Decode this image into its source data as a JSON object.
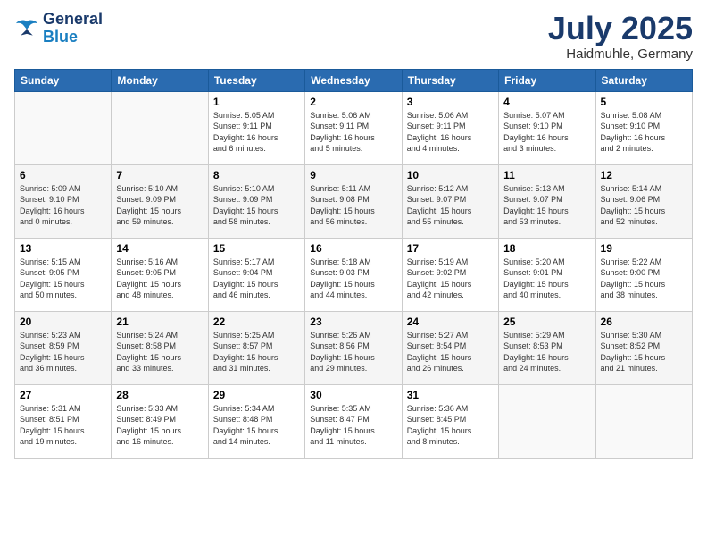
{
  "logo": {
    "line1": "General",
    "line2": "Blue"
  },
  "title": "July 2025",
  "location": "Haidmuhle, Germany",
  "weekdays": [
    "Sunday",
    "Monday",
    "Tuesday",
    "Wednesday",
    "Thursday",
    "Friday",
    "Saturday"
  ],
  "weeks": [
    [
      {
        "day": "",
        "info": ""
      },
      {
        "day": "",
        "info": ""
      },
      {
        "day": "1",
        "info": "Sunrise: 5:05 AM\nSunset: 9:11 PM\nDaylight: 16 hours\nand 6 minutes."
      },
      {
        "day": "2",
        "info": "Sunrise: 5:06 AM\nSunset: 9:11 PM\nDaylight: 16 hours\nand 5 minutes."
      },
      {
        "day": "3",
        "info": "Sunrise: 5:06 AM\nSunset: 9:11 PM\nDaylight: 16 hours\nand 4 minutes."
      },
      {
        "day": "4",
        "info": "Sunrise: 5:07 AM\nSunset: 9:10 PM\nDaylight: 16 hours\nand 3 minutes."
      },
      {
        "day": "5",
        "info": "Sunrise: 5:08 AM\nSunset: 9:10 PM\nDaylight: 16 hours\nand 2 minutes."
      }
    ],
    [
      {
        "day": "6",
        "info": "Sunrise: 5:09 AM\nSunset: 9:10 PM\nDaylight: 16 hours\nand 0 minutes."
      },
      {
        "day": "7",
        "info": "Sunrise: 5:10 AM\nSunset: 9:09 PM\nDaylight: 15 hours\nand 59 minutes."
      },
      {
        "day": "8",
        "info": "Sunrise: 5:10 AM\nSunset: 9:09 PM\nDaylight: 15 hours\nand 58 minutes."
      },
      {
        "day": "9",
        "info": "Sunrise: 5:11 AM\nSunset: 9:08 PM\nDaylight: 15 hours\nand 56 minutes."
      },
      {
        "day": "10",
        "info": "Sunrise: 5:12 AM\nSunset: 9:07 PM\nDaylight: 15 hours\nand 55 minutes."
      },
      {
        "day": "11",
        "info": "Sunrise: 5:13 AM\nSunset: 9:07 PM\nDaylight: 15 hours\nand 53 minutes."
      },
      {
        "day": "12",
        "info": "Sunrise: 5:14 AM\nSunset: 9:06 PM\nDaylight: 15 hours\nand 52 minutes."
      }
    ],
    [
      {
        "day": "13",
        "info": "Sunrise: 5:15 AM\nSunset: 9:05 PM\nDaylight: 15 hours\nand 50 minutes."
      },
      {
        "day": "14",
        "info": "Sunrise: 5:16 AM\nSunset: 9:05 PM\nDaylight: 15 hours\nand 48 minutes."
      },
      {
        "day": "15",
        "info": "Sunrise: 5:17 AM\nSunset: 9:04 PM\nDaylight: 15 hours\nand 46 minutes."
      },
      {
        "day": "16",
        "info": "Sunrise: 5:18 AM\nSunset: 9:03 PM\nDaylight: 15 hours\nand 44 minutes."
      },
      {
        "day": "17",
        "info": "Sunrise: 5:19 AM\nSunset: 9:02 PM\nDaylight: 15 hours\nand 42 minutes."
      },
      {
        "day": "18",
        "info": "Sunrise: 5:20 AM\nSunset: 9:01 PM\nDaylight: 15 hours\nand 40 minutes."
      },
      {
        "day": "19",
        "info": "Sunrise: 5:22 AM\nSunset: 9:00 PM\nDaylight: 15 hours\nand 38 minutes."
      }
    ],
    [
      {
        "day": "20",
        "info": "Sunrise: 5:23 AM\nSunset: 8:59 PM\nDaylight: 15 hours\nand 36 minutes."
      },
      {
        "day": "21",
        "info": "Sunrise: 5:24 AM\nSunset: 8:58 PM\nDaylight: 15 hours\nand 33 minutes."
      },
      {
        "day": "22",
        "info": "Sunrise: 5:25 AM\nSunset: 8:57 PM\nDaylight: 15 hours\nand 31 minutes."
      },
      {
        "day": "23",
        "info": "Sunrise: 5:26 AM\nSunset: 8:56 PM\nDaylight: 15 hours\nand 29 minutes."
      },
      {
        "day": "24",
        "info": "Sunrise: 5:27 AM\nSunset: 8:54 PM\nDaylight: 15 hours\nand 26 minutes."
      },
      {
        "day": "25",
        "info": "Sunrise: 5:29 AM\nSunset: 8:53 PM\nDaylight: 15 hours\nand 24 minutes."
      },
      {
        "day": "26",
        "info": "Sunrise: 5:30 AM\nSunset: 8:52 PM\nDaylight: 15 hours\nand 21 minutes."
      }
    ],
    [
      {
        "day": "27",
        "info": "Sunrise: 5:31 AM\nSunset: 8:51 PM\nDaylight: 15 hours\nand 19 minutes."
      },
      {
        "day": "28",
        "info": "Sunrise: 5:33 AM\nSunset: 8:49 PM\nDaylight: 15 hours\nand 16 minutes."
      },
      {
        "day": "29",
        "info": "Sunrise: 5:34 AM\nSunset: 8:48 PM\nDaylight: 15 hours\nand 14 minutes."
      },
      {
        "day": "30",
        "info": "Sunrise: 5:35 AM\nSunset: 8:47 PM\nDaylight: 15 hours\nand 11 minutes."
      },
      {
        "day": "31",
        "info": "Sunrise: 5:36 AM\nSunset: 8:45 PM\nDaylight: 15 hours\nand 8 minutes."
      },
      {
        "day": "",
        "info": ""
      },
      {
        "day": "",
        "info": ""
      }
    ]
  ]
}
